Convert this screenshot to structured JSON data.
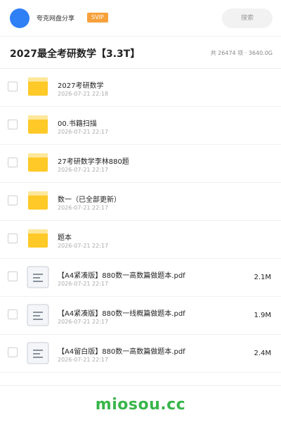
{
  "topbar": {
    "username": "夸克网盘分享",
    "badge": "SVIP",
    "search_label": "搜索",
    "accent_color": "#2f7ff5",
    "badge_color": "#f7a13b"
  },
  "header": {
    "title": "2027最全考研数学【3.3T】",
    "stats": "共 26474 项 · 3640.0G"
  },
  "files": [
    {
      "type": "folder",
      "icon": "folder-icon",
      "name": "2027考研数学",
      "date": "2026-07-21 22:18",
      "size": ""
    },
    {
      "type": "folder",
      "icon": "folder-icon",
      "name": "00.书籍扫描",
      "date": "2026-07-21 22:17",
      "size": ""
    },
    {
      "type": "folder",
      "icon": "folder-icon",
      "name": "27考研数学李林880题",
      "date": "2026-07-21 22:17",
      "size": ""
    },
    {
      "type": "folder",
      "icon": "folder-icon",
      "name": "数一（已全部更新）",
      "date": "2026-07-21 22:17",
      "size": ""
    },
    {
      "type": "folder",
      "icon": "folder-icon",
      "name": "题本",
      "date": "2026-07-21 22:17",
      "size": ""
    },
    {
      "type": "file",
      "icon": "document-icon",
      "name": "【A4紧凑版】880数一高数篇做题本.pdf",
      "date": "2026-07-21 22:17",
      "size": "2.1M"
    },
    {
      "type": "file",
      "icon": "document-icon",
      "name": "【A4紧凑版】880数一线概篇做题本.pdf",
      "date": "2026-07-21 22:17",
      "size": "1.9M"
    },
    {
      "type": "file",
      "icon": "document-icon",
      "name": "【A4留白版】880数一高数篇做题本.pdf",
      "date": "2026-07-21 22:17",
      "size": "2.4M"
    }
  ],
  "footer": {
    "watermark": "miosou.cc",
    "watermark_color": "#39b54a"
  }
}
